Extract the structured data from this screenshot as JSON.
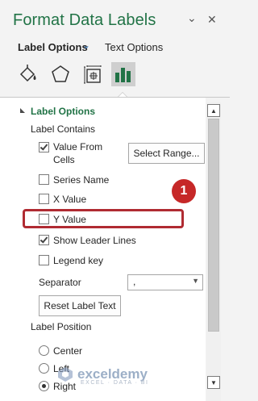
{
  "pane": {
    "title": "Format Data Labels",
    "pin_glyph": "⌄",
    "close_glyph": "✕"
  },
  "tabs": {
    "label_options": "Label Options",
    "chevron": "⌄",
    "text_options": "Text Options"
  },
  "icon_tabs": [
    {
      "name": "fill-line-icon",
      "selected": false
    },
    {
      "name": "effects-pentagon-icon",
      "selected": false
    },
    {
      "name": "size-properties-icon",
      "selected": false
    },
    {
      "name": "label-options-bar-chart-icon",
      "selected": true
    }
  ],
  "section": {
    "title": "Label Options",
    "contains_heading": "Label Contains",
    "value_from_cells_1": "Value From",
    "value_from_cells_2": "Cells",
    "select_range": "Select Range...",
    "series_name": "Series Name",
    "x_value": "X Value",
    "y_value": "Y Value",
    "show_leader_lines": "Show Leader Lines",
    "legend_key": "Legend key",
    "separator_label": "Separator",
    "separator_value": ",",
    "reset_label_text": "Reset Label Text",
    "position_heading": "Label Position",
    "center": "Center",
    "left": "Left",
    "right": "Right"
  },
  "checks": {
    "value_from_cells": true,
    "series_name": false,
    "x_value": false,
    "y_value": false,
    "show_leader_lines": true,
    "legend_key": false
  },
  "radios": {
    "center": false,
    "left": false,
    "right": true
  },
  "annotation": {
    "badge": "1",
    "highlight_color": "#b02b32"
  },
  "watermark": {
    "brand": "exceldemy",
    "tagline": "EXCEL · DATA · BI"
  },
  "colors": {
    "accent": "#217346",
    "background": "#f3f3f3",
    "content": "#ffffff"
  }
}
